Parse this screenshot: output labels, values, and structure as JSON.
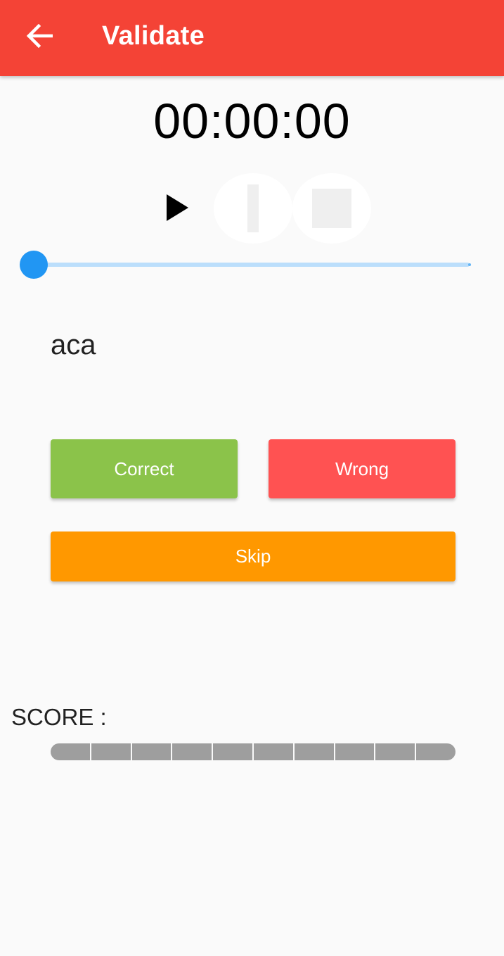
{
  "appbar": {
    "title": "Validate",
    "back_icon": "arrow-back-icon",
    "color": "#f44336"
  },
  "player": {
    "time": "00:00:00",
    "play_icon": "play-icon",
    "pause_icon": "pause-icon",
    "stop_icon": "stop-icon",
    "progress": 0
  },
  "word": "aca",
  "buttons": {
    "correct": "Correct",
    "wrong": "Wrong",
    "skip": "Skip"
  },
  "score": {
    "label": "SCORE :",
    "segments": 10,
    "filled": 0
  },
  "colors": {
    "correct": "#8bc34a",
    "wrong": "#ff5252",
    "skip": "#ff9800",
    "slider": "#2196f3"
  }
}
